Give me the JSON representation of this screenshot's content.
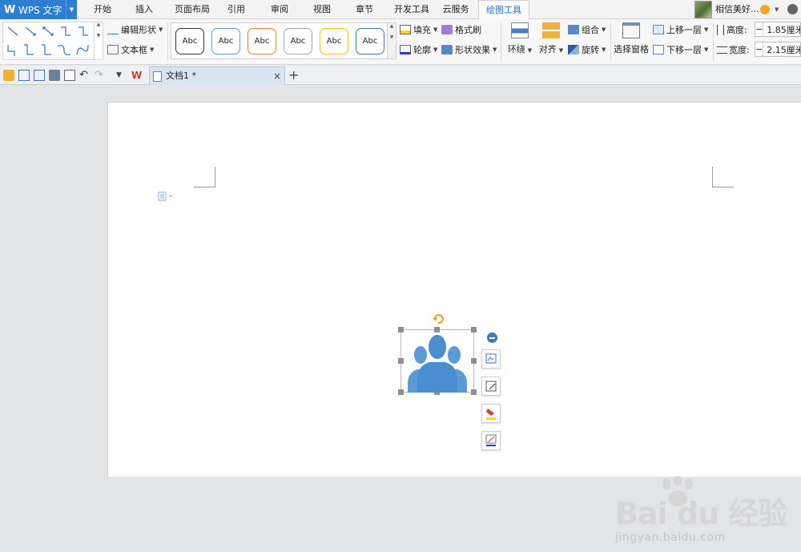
{
  "app": {
    "name": "WPS 文字",
    "logo_text": "W"
  },
  "menu": {
    "tabs": [
      {
        "label": "开始"
      },
      {
        "label": "插入"
      },
      {
        "label": "页面布局"
      },
      {
        "label": "引用"
      },
      {
        "label": "审阅"
      },
      {
        "label": "视图"
      },
      {
        "label": "章节"
      },
      {
        "label": "开发工具"
      },
      {
        "label": "云服务"
      },
      {
        "label": "绘图工具"
      }
    ],
    "active_tab": "绘图工具"
  },
  "user": {
    "name": "相信美好..."
  },
  "ribbon": {
    "edit_shape": "编辑形状",
    "text_box": "文本框",
    "style_gallery": [
      {
        "label": "Abc",
        "border": "#333333"
      },
      {
        "label": "Abc",
        "border": "#5b9bd5"
      },
      {
        "label": "Abc",
        "border": "#ed7d31"
      },
      {
        "label": "Abc",
        "border": "#a5a5a5"
      },
      {
        "label": "Abc",
        "border": "#ffc000"
      },
      {
        "label": "Abc",
        "border": "#4472c4"
      }
    ],
    "fill": "填充",
    "format_painter": "格式刷",
    "outline": "轮廓",
    "shape_effects": "形状效果",
    "wrap": "环绕",
    "align": "对齐",
    "group": "组合",
    "rotate": "旋转",
    "selection_pane": "选择窗格",
    "bring_forward": "上移一层",
    "send_backward": "下移一层",
    "height_label": "高度:",
    "height_value": "1.85厘米",
    "width_label": "宽度:",
    "width_value": "2.15厘米",
    "minus": "−"
  },
  "tabbar": {
    "document_title": "文档1 *",
    "close_symbol": "×",
    "new_tab_symbol": "+"
  },
  "colors": {
    "accent": "#2d7dd2",
    "shape_fill": "#5b9bd5",
    "rotate_handle": "#f0a020"
  },
  "watermark": {
    "brand": "Bai du 经验",
    "url": "jingyan.baidu.com"
  }
}
